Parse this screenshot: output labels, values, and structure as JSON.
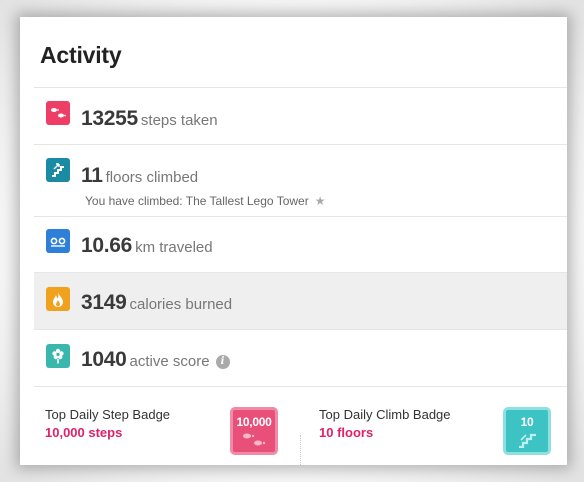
{
  "panel": {
    "title": "Activity"
  },
  "rows": [
    {
      "number": "13255",
      "unit": "steps taken",
      "icon": "footsteps-icon",
      "color": "#ef3e66"
    },
    {
      "number": "11",
      "unit": "floors climbed",
      "icon": "stairs-icon",
      "color": "#1b8aa3",
      "note": "You have climbed: The Tallest Lego Tower"
    },
    {
      "number": "10.66",
      "unit": "km traveled",
      "icon": "distance-icon",
      "color": "#2d7fd8"
    },
    {
      "number": "3149",
      "unit": "calories burned",
      "icon": "flame-icon",
      "color": "#f0a21e"
    },
    {
      "number": "1040",
      "unit": "active score",
      "icon": "flower-icon",
      "color": "#3ab7ad"
    }
  ],
  "badges": [
    {
      "title": "Top Daily Step Badge",
      "value": "10,000 steps",
      "badge_label": "10,000",
      "color": "#e8507a"
    },
    {
      "title": "Top Daily Climb Badge",
      "value": "10 floors",
      "badge_label": "10",
      "color": "#3dc3c4"
    }
  ],
  "accent_color": "#e0206a"
}
